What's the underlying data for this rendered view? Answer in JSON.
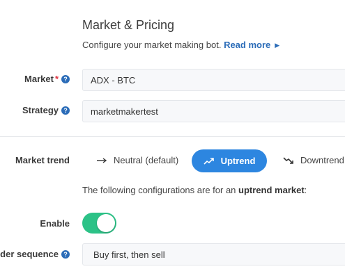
{
  "section": {
    "title": "Market & Pricing",
    "description": "Configure your market making bot.",
    "read_more": "Read more"
  },
  "market": {
    "label": "Market",
    "required_mark": "*",
    "value": "ADX - BTC"
  },
  "strategy": {
    "label": "Strategy",
    "value": "marketmakertest"
  },
  "market_trend": {
    "label": "Market trend",
    "options": [
      {
        "label": "Neutral (default)",
        "icon": "arrow-right-icon",
        "selected": false
      },
      {
        "label": "Uptrend",
        "icon": "trend-up-icon",
        "selected": true
      },
      {
        "label": "Downtrend",
        "icon": "trend-down-icon",
        "selected": false
      }
    ]
  },
  "info": {
    "prefix": "The following configurations are for an",
    "emphasis": "uptrend market",
    "suffix": ":"
  },
  "enable": {
    "label": "Enable",
    "on": true
  },
  "order_sequence": {
    "label": "Order sequence",
    "value": "Buy first, then sell"
  },
  "colors": {
    "accent": "#2b6cb8",
    "active_button": "#2d86e0",
    "toggle_on": "#2cc287",
    "required": "#e0303e"
  }
}
